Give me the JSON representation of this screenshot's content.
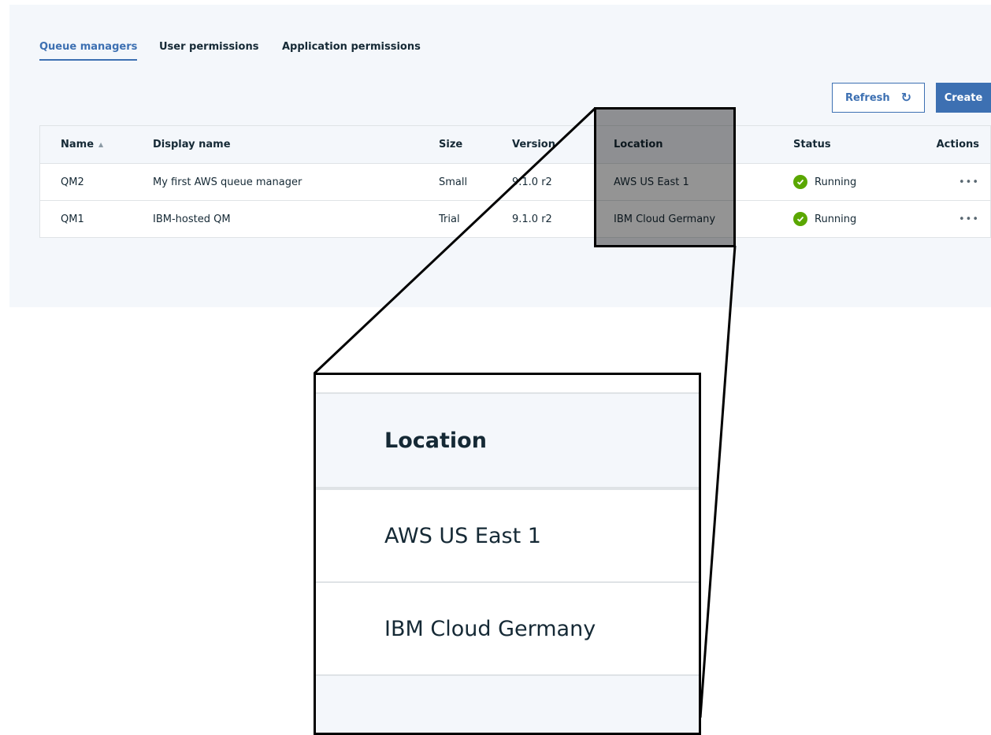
{
  "tabs": [
    {
      "label": "Queue managers",
      "active": true
    },
    {
      "label": "User permissions",
      "active": false
    },
    {
      "label": "Application permissions",
      "active": false
    }
  ],
  "toolbar": {
    "refresh_label": "Refresh",
    "refresh_icon": "↻",
    "create_label": "Create"
  },
  "table": {
    "columns": [
      "Name",
      "Display name",
      "Size",
      "Version",
      "Location",
      "Status",
      "Actions"
    ],
    "sort_indicator": "▲",
    "rows": [
      {
        "name": "QM2",
        "display_name": "My first AWS queue manager",
        "size": "Small",
        "version": "9.1.0 r2",
        "location": "AWS US East 1",
        "status": "Running",
        "actions": "•••"
      },
      {
        "name": "QM1",
        "display_name": "IBM-hosted QM",
        "size": "Trial",
        "version": "9.1.0 r2",
        "location": "IBM Cloud Germany",
        "status": "Running",
        "actions": "•••"
      }
    ]
  },
  "zoom": {
    "header": "Location",
    "values": [
      "AWS US East 1",
      "IBM Cloud Germany"
    ]
  },
  "colors": {
    "accent": "#3d70b2",
    "status_running": "#5aa700",
    "panel_bg": "#f4f7fb"
  }
}
